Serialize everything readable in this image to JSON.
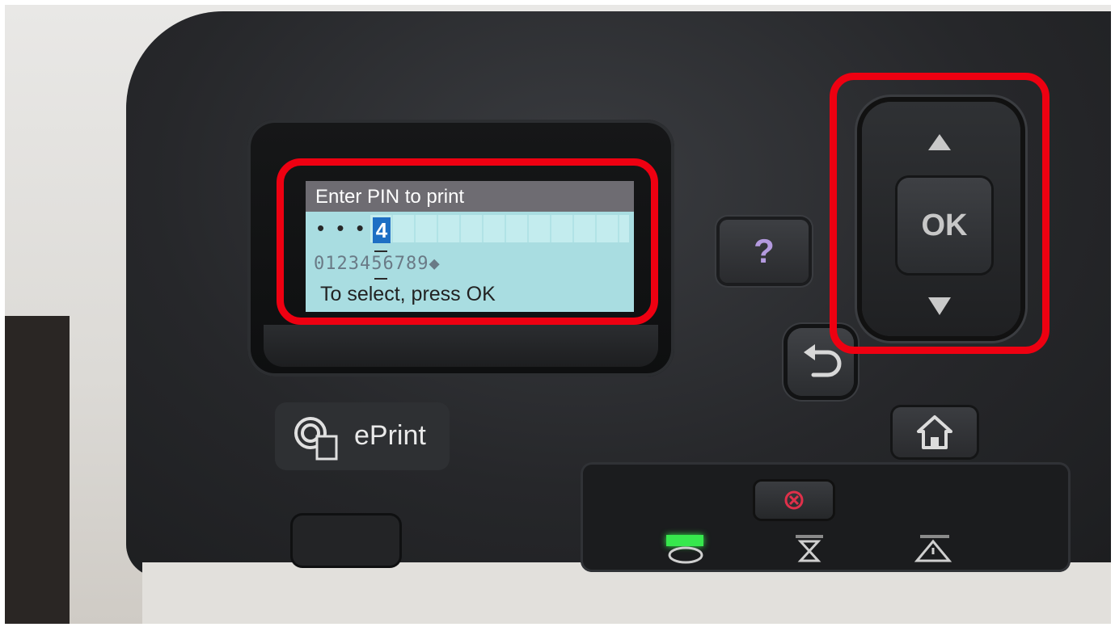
{
  "lcd": {
    "title": "Enter PIN to print",
    "pin_masked": "• • •",
    "pin_current_digit": "4",
    "digit_selector": "0123456789◆",
    "hint": "To select, press OK"
  },
  "buttons": {
    "ok_label": "OK",
    "help_label": "?",
    "eprint_label": "ePrint"
  },
  "icons": {
    "up": "arrow-up-icon",
    "down": "arrow-down-icon",
    "back": "back-icon",
    "home": "home-icon",
    "cancel": "cancel-icon",
    "ready": "ready-light-icon",
    "data": "data-light-icon",
    "attention": "attention-icon",
    "eprint": "eprint-icon"
  },
  "colors": {
    "highlight": "#ee0011",
    "lcd_background": "#a9dde1",
    "ready_led": "#37e84d",
    "help_icon": "#b49adf"
  }
}
